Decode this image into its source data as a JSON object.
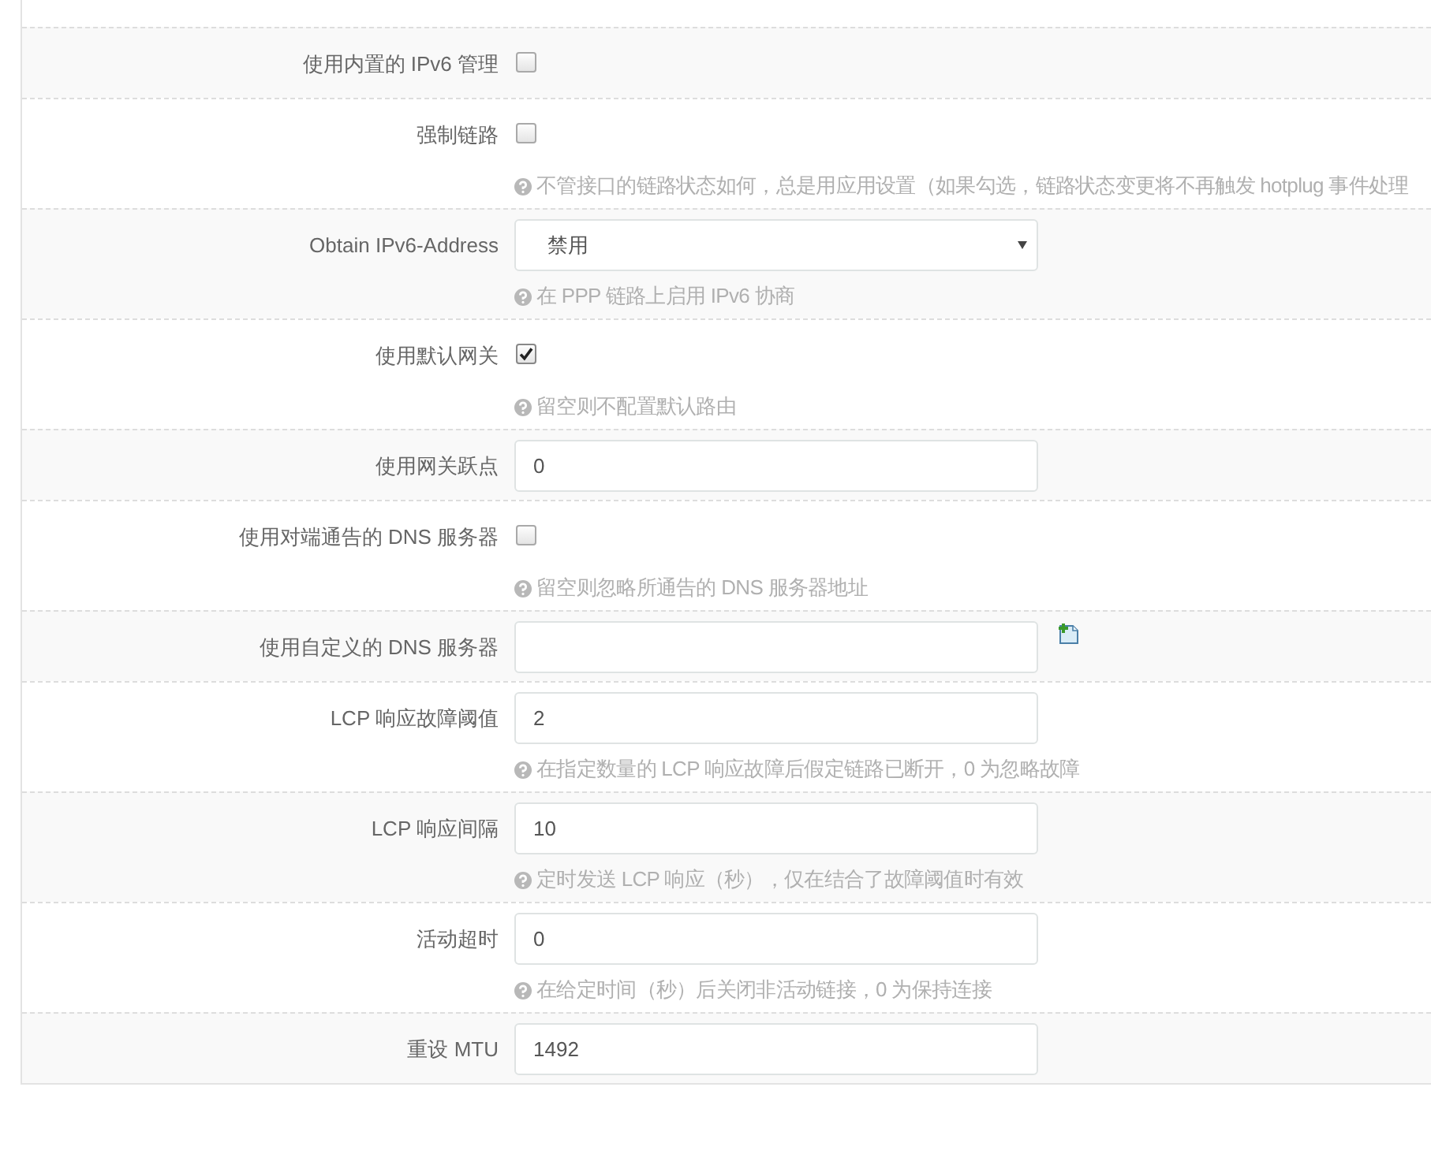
{
  "form": {
    "rows": [
      {
        "label": "使用内置的 IPv6 管理",
        "kind": "checkbox",
        "checked": false
      },
      {
        "label": "强制链路",
        "kind": "checkbox",
        "checked": false,
        "help": "不管接口的链路状态如何，总是用应用设置（如果勾选，链路状态变更将不再触发 hotplug 事件处理"
      },
      {
        "label": "Obtain IPv6-Address",
        "kind": "select",
        "value": "禁用",
        "help": "在 PPP 链路上启用 IPv6 协商"
      },
      {
        "label": "使用默认网关",
        "kind": "checkbox",
        "checked": true,
        "help": "留空则不配置默认路由"
      },
      {
        "label": "使用网关跃点",
        "kind": "text",
        "value": "0"
      },
      {
        "label": "使用对端通告的 DNS 服务器",
        "kind": "checkbox",
        "checked": false,
        "help": "留空则忽略所通告的 DNS 服务器地址"
      },
      {
        "label": "使用自定义的 DNS 服务器",
        "kind": "list"
      },
      {
        "label": "LCP 响应故障阈值",
        "kind": "text",
        "value": "2",
        "help": "在指定数量的 LCP 响应故障后假定链路已断开，0 为忽略故障"
      },
      {
        "label": "LCP 响应间隔",
        "kind": "text",
        "value": "10",
        "help": "定时发送 LCP 响应（秒），仅在结合了故障阈值时有效"
      },
      {
        "label": "活动超时",
        "kind": "text",
        "value": "0",
        "help": "在给定时间（秒）后关闭非活动链接，0 为保持连接"
      },
      {
        "label": "重设 MTU",
        "kind": "text",
        "value": "1492"
      }
    ]
  }
}
